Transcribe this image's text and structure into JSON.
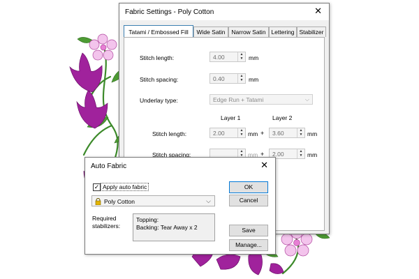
{
  "fabric_settings": {
    "title": "Fabric Settings - Poly Cotton",
    "tabs": [
      {
        "label": "Tatami / Embossed Fill"
      },
      {
        "label": "Wide Satin"
      },
      {
        "label": "Narrow Satin"
      },
      {
        "label": "Lettering"
      },
      {
        "label": "Stabilizer"
      }
    ],
    "stitch_length": {
      "label": "Stitch length:",
      "value": "4.00",
      "unit": "mm"
    },
    "stitch_spacing": {
      "label": "Stitch spacing:",
      "value": "0.40",
      "unit": "mm"
    },
    "underlay_type": {
      "label": "Underlay type:",
      "value": "Edge Run + Tatami"
    },
    "layer1_label": "Layer 1",
    "layer2_label": "Layer 2",
    "layer_stitch_length": {
      "label": "Stitch length:",
      "layer1": "2.00",
      "layer2": "3.60",
      "unit": "mm",
      "plus": "+"
    },
    "layer_stitch_spacing": {
      "label": "Stitch spacing:",
      "layer1": "",
      "layer2": "2.00",
      "unit": "mm",
      "plus": "+"
    }
  },
  "auto_fabric": {
    "title": "Auto Fabric",
    "apply_label": "Apply auto fabric",
    "apply_checked": "✓",
    "fabric_selected": "Poly Cotton",
    "required_label_line1": "Required",
    "required_label_line2": "stabilizers:",
    "stabilizers": [
      "Topping:",
      "Backing: Tear Away x 2"
    ],
    "buttons": {
      "ok": "OK",
      "cancel": "Cancel",
      "save": "Save",
      "manage": "Manage..."
    }
  },
  "colors": {
    "magenta": "#a0229c",
    "pink": "#f3c4ec",
    "leaf": "#3c8a2a",
    "accent": "#0078d7"
  }
}
